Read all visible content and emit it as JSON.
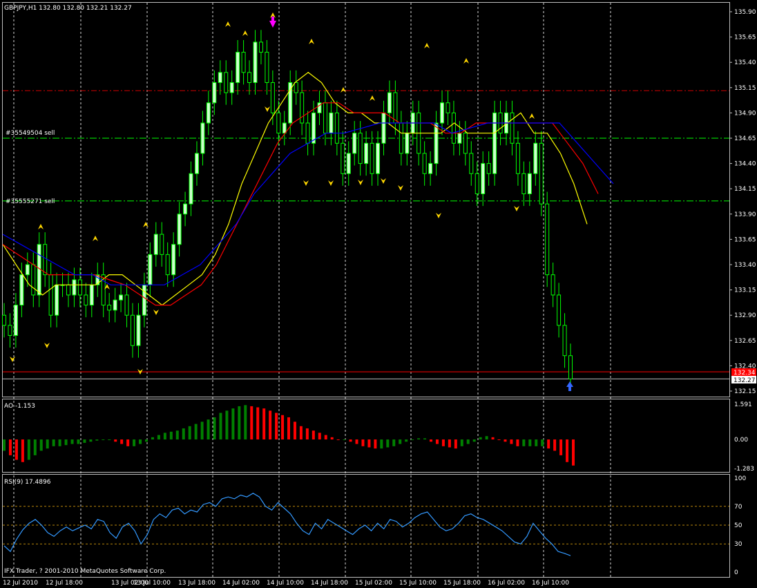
{
  "header": {
    "symbol_line": "GBPJPY,H1  132.80 132.80 132.21 132.27",
    "ao_label": "AO -1.153",
    "rsi_label": "RSI(9) 17.4896",
    "footer": "IFX Trader, ? 2001-2010 MetaQuotes Software Corp."
  },
  "orders": [
    {
      "label": "#35549504 sell",
      "price": 134.65
    },
    {
      "label": "#35555271 sell",
      "price": 134.03
    }
  ],
  "price_scale": {
    "ticks": [
      "135.90",
      "135.65",
      "135.40",
      "135.15",
      "134.90",
      "134.65",
      "134.40",
      "134.15",
      "133.90",
      "133.65",
      "133.40",
      "133.15",
      "132.90",
      "132.65",
      "132.40",
      "132.15"
    ],
    "bid_label": "132.34",
    "bid_price": 132.34,
    "last_label": "132.27",
    "last_price": 132.27
  },
  "ao_scale": {
    "ticks": [
      "1.591",
      "0.00",
      "-1.283"
    ]
  },
  "rsi_scale": {
    "ticks": [
      "100",
      "70",
      "50",
      "30",
      "0"
    ]
  },
  "time_axis": {
    "labels": [
      "12 Jul 2010",
      "12 Jul 18:00",
      "13 Jul 02:00",
      "13 Jul 10:00",
      "13 Jul 18:00",
      "14 Jul 02:00",
      "14 Jul 10:00",
      "14 Jul 18:00",
      "15 Jul 02:00",
      "15 Jul 10:00",
      "15 Jul 18:00",
      "16 Jul 02:00",
      "16 Jul 10:00"
    ]
  },
  "colors": {
    "bull_candle": "#ccffcc",
    "bear_candle": "#000000",
    "wick": "#00ff00",
    "ma_fast": "#ffff00",
    "ma_mid": "#ff0000",
    "ma_slow": "#0000ff",
    "grid": "#ffffff",
    "order_line": "#00cc00",
    "resistance": "#cc0000",
    "ao_up": "#008000",
    "ao_down": "#ff0000",
    "rsi_line": "#3399ff",
    "level_line": "#b8860b",
    "fractal": "#ffd700"
  },
  "chart_data": [
    {
      "type": "candlestick",
      "symbol": "GBPJPY",
      "timeframe": "H1",
      "ylim": [
        132.15,
        135.9
      ],
      "horizontal_lines": [
        {
          "price": 135.12,
          "style": "dash-dot",
          "color": "#cc0000"
        },
        {
          "price": 132.34,
          "style": "solid",
          "color": "#ff0000"
        },
        {
          "price": 132.27,
          "style": "solid",
          "color": "#c0c0c0"
        }
      ],
      "close_series": [
        132.8,
        132.7,
        133.0,
        133.3,
        133.4,
        133.1,
        133.6,
        133.3,
        132.9,
        133.2,
        133.2,
        133.1,
        133.25,
        133.1,
        133.0,
        133.2,
        133.3,
        133.0,
        132.95,
        133.05,
        133.1,
        132.9,
        132.6,
        132.9,
        133.2,
        133.5,
        133.7,
        133.5,
        133.3,
        133.6,
        133.9,
        134.0,
        134.3,
        134.5,
        134.8,
        135.0,
        135.2,
        135.3,
        135.1,
        135.2,
        135.5,
        135.3,
        135.2,
        135.6,
        135.5,
        135.2,
        134.9,
        134.7,
        134.8,
        135.2,
        135.1,
        134.8,
        134.6,
        134.9,
        135.0,
        134.7,
        134.9,
        134.6,
        134.3,
        134.5,
        134.7,
        134.4,
        134.6,
        134.3,
        134.6,
        134.9,
        135.1,
        134.8,
        134.5,
        134.7,
        134.9,
        134.5,
        134.3,
        134.4,
        134.8,
        135.0,
        134.9,
        134.6,
        134.7,
        134.5,
        134.3,
        134.1,
        134.4,
        134.3,
        134.9,
        134.7,
        134.9,
        134.6,
        134.3,
        134.1,
        134.3,
        134.6,
        134.0,
        133.3,
        133.1,
        132.8,
        132.5,
        132.27
      ],
      "ma_fast_series": [
        133.6,
        133.4,
        133.2,
        133.1,
        133.2,
        133.2,
        133.2,
        133.2,
        133.3,
        133.3,
        133.2,
        133.1,
        133.0,
        133.1,
        133.2,
        133.3,
        133.5,
        133.8,
        134.2,
        134.5,
        134.8,
        135.0,
        135.2,
        135.3,
        135.2,
        135.0,
        134.9,
        134.9,
        134.8,
        134.8,
        134.7,
        134.7,
        134.7,
        134.7,
        134.8,
        134.7,
        134.7,
        134.7,
        134.8,
        134.9,
        134.7,
        134.7,
        134.5,
        134.2,
        133.8
      ],
      "ma_mid_series": [
        133.6,
        133.5,
        133.4,
        133.3,
        133.3,
        133.3,
        133.3,
        133.25,
        133.2,
        133.1,
        133.0,
        133.0,
        133.1,
        133.2,
        133.4,
        133.7,
        134.0,
        134.3,
        134.6,
        134.8,
        134.9,
        135.0,
        135.0,
        134.9,
        134.9,
        134.9,
        134.8,
        134.8,
        134.8,
        134.7,
        134.7,
        134.8,
        134.8,
        134.8,
        134.8,
        134.8,
        134.8,
        134.6,
        134.4,
        134.1
      ],
      "ma_slow_series": [
        133.7,
        133.6,
        133.5,
        133.4,
        133.3,
        133.3,
        133.2,
        133.2,
        133.2,
        133.2,
        133.3,
        133.4,
        133.6,
        133.8,
        134.1,
        134.3,
        134.5,
        134.6,
        134.7,
        134.7,
        134.75,
        134.8,
        134.8,
        134.8,
        134.8,
        134.7,
        134.75,
        134.8,
        134.8,
        134.8,
        134.8,
        134.8,
        134.6,
        134.4,
        134.2
      ]
    },
    {
      "type": "bar",
      "name": "AO",
      "ylim": [
        -1.283,
        1.591
      ],
      "values": [
        -0.5,
        -0.7,
        -0.9,
        -1.0,
        -0.9,
        -0.7,
        -0.5,
        -0.4,
        -0.3,
        -0.3,
        -0.25,
        -0.2,
        -0.2,
        -0.15,
        -0.1,
        -0.05,
        0.0,
        0.0,
        -0.1,
        -0.2,
        -0.3,
        -0.3,
        -0.2,
        -0.1,
        0.1,
        0.2,
        0.3,
        0.35,
        0.4,
        0.5,
        0.6,
        0.7,
        0.8,
        0.9,
        1.0,
        1.2,
        1.3,
        1.4,
        1.5,
        1.55,
        1.5,
        1.45,
        1.4,
        1.3,
        1.2,
        1.1,
        1.0,
        0.8,
        0.6,
        0.5,
        0.4,
        0.3,
        0.2,
        0.1,
        0.0,
        0.0,
        -0.1,
        -0.2,
        -0.3,
        -0.35,
        -0.4,
        -0.4,
        -0.35,
        -0.3,
        -0.2,
        -0.1,
        0.0,
        0.05,
        0.05,
        -0.1,
        -0.2,
        -0.3,
        -0.35,
        -0.4,
        -0.3,
        -0.2,
        -0.1,
        0.1,
        0.15,
        0.1,
        0.0,
        -0.1,
        -0.2,
        -0.3,
        -0.3,
        -0.3,
        -0.3,
        -0.3,
        -0.4,
        -0.5,
        -0.7,
        -1.0,
        -1.153
      ]
    },
    {
      "type": "line",
      "name": "RSI(9)",
      "ylim": [
        0,
        100
      ],
      "levels": [
        30,
        50,
        70
      ],
      "values": [
        28,
        22,
        35,
        45,
        52,
        56,
        50,
        42,
        38,
        44,
        48,
        44,
        47,
        50,
        46,
        56,
        54,
        42,
        36,
        48,
        52,
        44,
        30,
        40,
        56,
        62,
        58,
        66,
        68,
        62,
        66,
        64,
        72,
        74,
        70,
        78,
        80,
        78,
        82,
        80,
        84,
        80,
        70,
        66,
        74,
        68,
        62,
        52,
        44,
        40,
        52,
        46,
        56,
        52,
        48,
        44,
        40,
        46,
        50,
        44,
        52,
        46,
        56,
        54,
        48,
        52,
        58,
        62,
        64,
        56,
        48,
        44,
        46,
        52,
        60,
        62,
        58,
        56,
        52,
        48,
        44,
        38,
        32,
        30,
        38,
        52,
        44,
        36,
        30,
        22,
        20,
        17.5
      ]
    }
  ]
}
